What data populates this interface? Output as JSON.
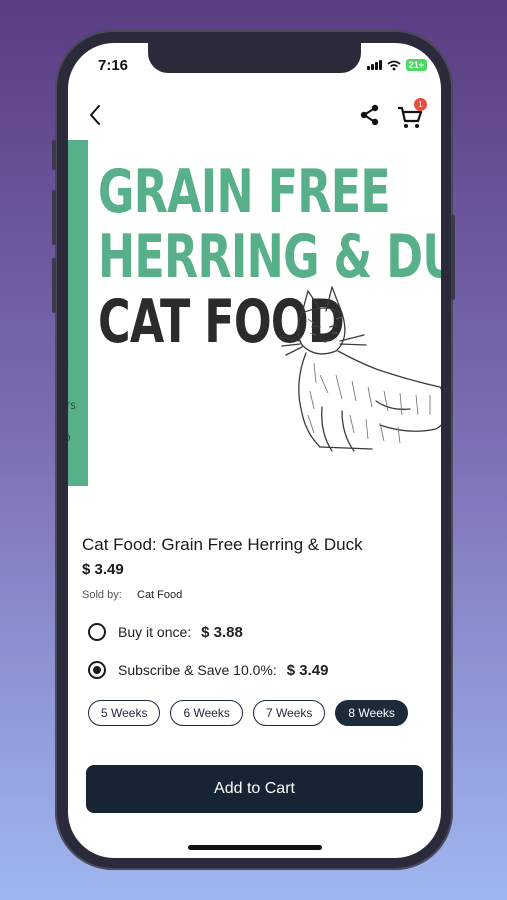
{
  "status_bar": {
    "time": "7:16",
    "battery": "21+"
  },
  "navbar": {
    "cart_count": "1"
  },
  "hero": {
    "line1": "GRAIN FREE",
    "line2": "HERRING & DUCK",
    "line3": "CAT FOOD",
    "side_fragments": [
      ":",
      "TS",
      "0"
    ],
    "accent_color": "#57b08a"
  },
  "product": {
    "title": "Cat Food: Grain Free Herring & Duck",
    "price": "$ 3.49",
    "sold_by_label": "Sold by:",
    "sold_by_value": "Cat Food"
  },
  "purchase_options": [
    {
      "label": "Buy it once:",
      "price": "$ 3.88",
      "selected": false
    },
    {
      "label": "Subscribe & Save 10.0%:",
      "price": "$ 3.49",
      "selected": true
    }
  ],
  "frequency_options": [
    {
      "label": "5 Weeks",
      "selected": false
    },
    {
      "label": "6 Weeks",
      "selected": false
    },
    {
      "label": "7 Weeks",
      "selected": false
    },
    {
      "label": "8 Weeks",
      "selected": true
    }
  ],
  "add_to_cart_label": "Add to Cart",
  "colors": {
    "primary_dark": "#172434",
    "badge": "#e74c3c",
    "battery": "#4cd964"
  }
}
